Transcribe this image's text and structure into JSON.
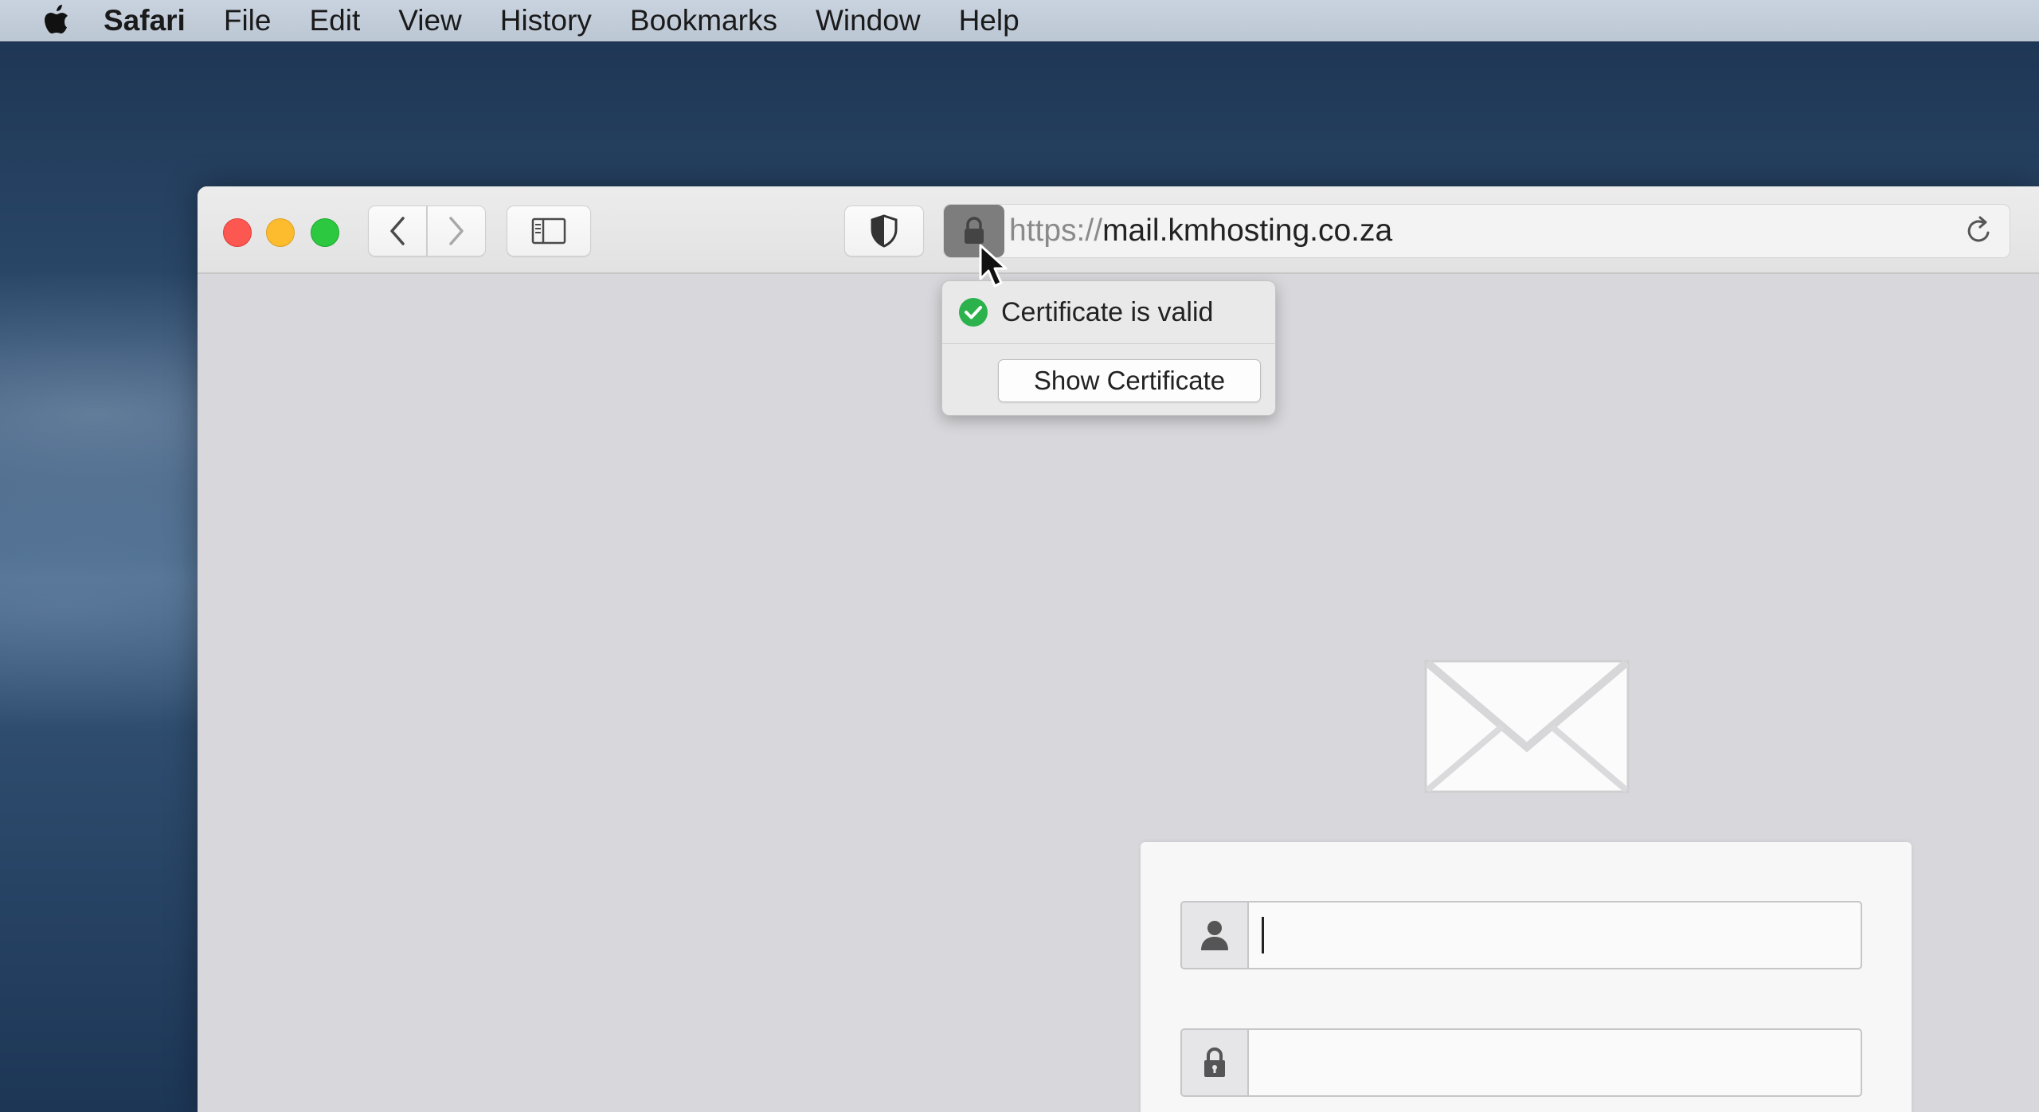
{
  "menubar": {
    "app_name": "Safari",
    "items": [
      {
        "label": "File"
      },
      {
        "label": "Edit"
      },
      {
        "label": "View"
      },
      {
        "label": "History"
      },
      {
        "label": "Bookmarks"
      },
      {
        "label": "Window"
      },
      {
        "label": "Help"
      }
    ]
  },
  "window": {
    "toolbar": {
      "back_icon": "chevron-left-icon",
      "forward_icon": "chevron-right-icon",
      "sidebar_icon": "sidebar-icon",
      "privacy_icon": "shield-icon",
      "address": {
        "scheme": "https://",
        "host": "mail.kmhosting.co.za",
        "lock_icon": "lock-icon",
        "reload_icon": "reload-icon"
      }
    },
    "certificate_popover": {
      "status_text": "Certificate is valid",
      "status_color": "#2bb24c",
      "button_label": "Show Certificate"
    },
    "page": {
      "logo_icon": "envelope-icon",
      "username": {
        "value": "",
        "icon": "user-icon"
      },
      "password": {
        "value": "",
        "icon": "lock-icon"
      }
    }
  },
  "colors": {
    "close": "#fd5752",
    "minimize": "#fdbb2e",
    "zoom": "#2bc840",
    "lock_button_bg": "#7d7d7d"
  }
}
